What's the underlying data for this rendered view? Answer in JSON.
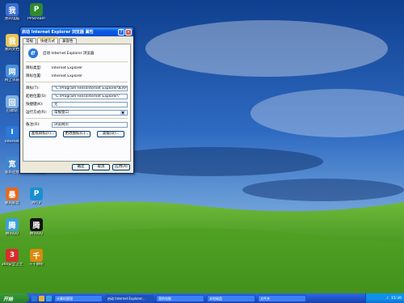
{
  "desktop_icons": [
    {
      "label": "我的电脑",
      "icon": "computer-icon",
      "color": "#3a6fd0"
    },
    {
      "label": "我的文档",
      "icon": "documents-icon",
      "color": "#e6c65a"
    },
    {
      "label": "网上邻居",
      "icon": "network-icon",
      "color": "#4b8fd8"
    },
    {
      "label": "回收站",
      "icon": "recycle-bin-icon",
      "color": "#7fb0e0"
    },
    {
      "label": "Internet",
      "icon": "internet-explorer-icon",
      "color": "#2a78d8"
    },
    {
      "label": "宽带连接",
      "icon": "broadband-icon",
      "color": "#3f86d0"
    },
    {
      "label": "暴风影音",
      "icon": "media-player-icon",
      "color": "#e26b22"
    },
    {
      "label": "腾讯QQ",
      "icon": "qq-icon",
      "color": "#3aa0e0"
    },
    {
      "label": "360安全卫士",
      "icon": "security-icon",
      "color": "#d72d2d"
    },
    {
      "label": "PPStream",
      "icon": "ppstream-icon",
      "color": "#2f8a2f"
    },
    {
      "label": "千千静听",
      "icon": "music-player-icon",
      "color": "#e4a512"
    },
    {
      "label": "驱动精灵",
      "icon": "driver-icon",
      "color": "#5aa82e"
    },
    {
      "label": "酷狗音乐",
      "icon": "kugou-icon",
      "color": "#2a7ad8"
    },
    {
      "label": "迅雷",
      "icon": "thunder-icon",
      "color": "#3a3a3a"
    },
    {
      "label": "360浏览器",
      "icon": "browser-icon",
      "color": "#4a9a2a"
    },
    {
      "label": "PPTV",
      "icon": "pptv-icon",
      "color": "#1a8fd0"
    },
    {
      "label": "腾讯QQ",
      "icon": "qq-penguin-icon",
      "color": "#111111"
    },
    {
      "label": "千千静听",
      "icon": "music-icon",
      "color": "#d98a10"
    }
  ],
  "dialog": {
    "title": "启动 Internet Explorer 浏览器 属性",
    "tabs": [
      "常规",
      "快捷方式",
      "兼容性"
    ],
    "active_tab": "快捷方式",
    "header_text": "启动 Internet Explorer 浏览器",
    "rows": [
      {
        "key": "目标类型:",
        "value": "Internet Explorer",
        "kind": "text"
      },
      {
        "key": "目标位置:",
        "value": "Internet Explorer",
        "kind": "text"
      },
      {
        "key": "目标(T):",
        "value": "\"C:\\Program Files\\Internet Explorer\\IEXPLORE.EXE\"",
        "kind": "field"
      },
      {
        "key": "起始位置(S):",
        "value": "\"C:\\Program Files\\Internet Explorer\\\"",
        "kind": "field"
      },
      {
        "key": "快捷键(K):",
        "value": "无",
        "kind": "field"
      },
      {
        "key": "运行方式(R):",
        "value": "常规窗口",
        "kind": "select"
      },
      {
        "key": "备注(O):",
        "value": "浏览网页",
        "kind": "field"
      }
    ],
    "buttons": [
      "查找目标(F)...",
      "更改图标(C)...",
      "高级(D)..."
    ],
    "footer_buttons": [
      "确定",
      "取消",
      "应用(A)"
    ]
  },
  "taskbar": {
    "start_label": "开始",
    "tasks": [
      "计算机管理",
      "启动 Internet Explorer...",
      "我的电脑",
      "本地磁盘",
      "文件夹"
    ],
    "active_task_index": 1,
    "clock": "15:30"
  }
}
